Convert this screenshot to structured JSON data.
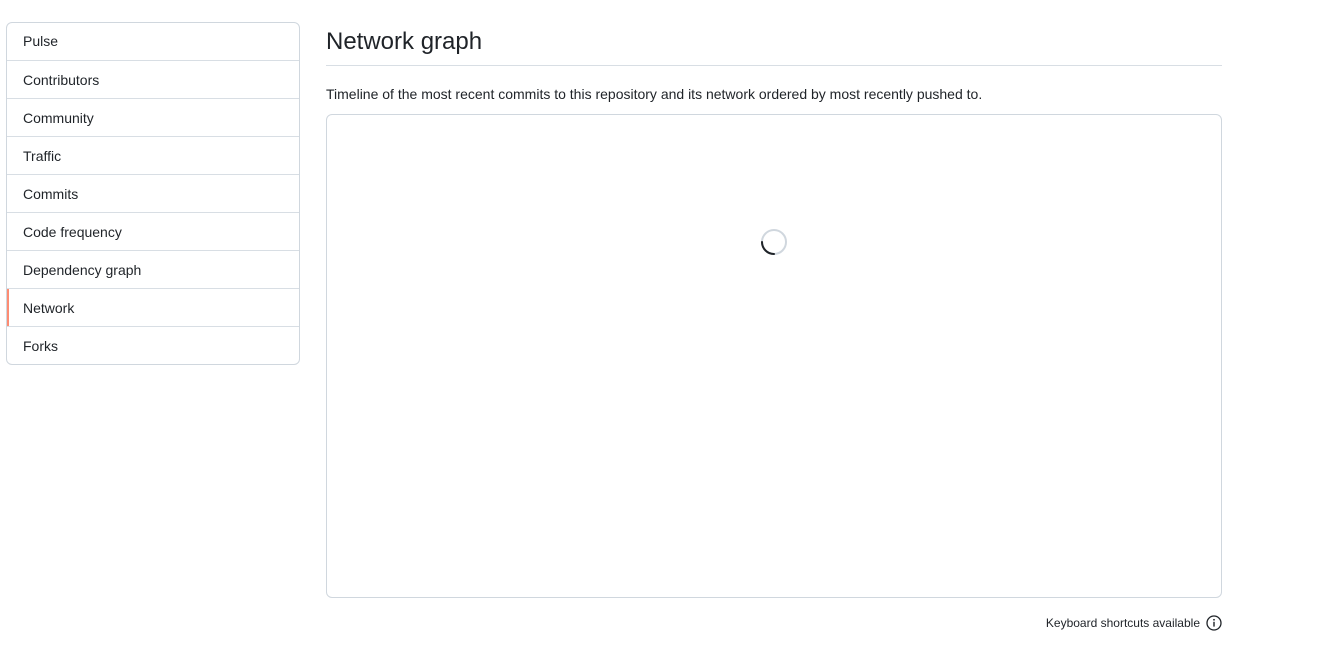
{
  "sidebar": {
    "items": [
      {
        "label": "Pulse"
      },
      {
        "label": "Contributors"
      },
      {
        "label": "Community"
      },
      {
        "label": "Traffic"
      },
      {
        "label": "Commits"
      },
      {
        "label": "Code frequency"
      },
      {
        "label": "Dependency graph"
      },
      {
        "label": "Network",
        "selected": true
      },
      {
        "label": "Forks"
      }
    ],
    "selected_accent_color": "#fd8c73"
  },
  "main": {
    "title": "Network graph",
    "description": "Timeline of the most recent commits to this repository and its network ordered by most recently pushed to.",
    "graph_state": "loading",
    "spinner_icon": "loading-spinner-icon"
  },
  "footer": {
    "keyboard_hint": "Keyboard shortcuts available",
    "hint_icon": "info-icon"
  },
  "colors": {
    "border": "#d0d7de",
    "text": "#1f2328"
  }
}
